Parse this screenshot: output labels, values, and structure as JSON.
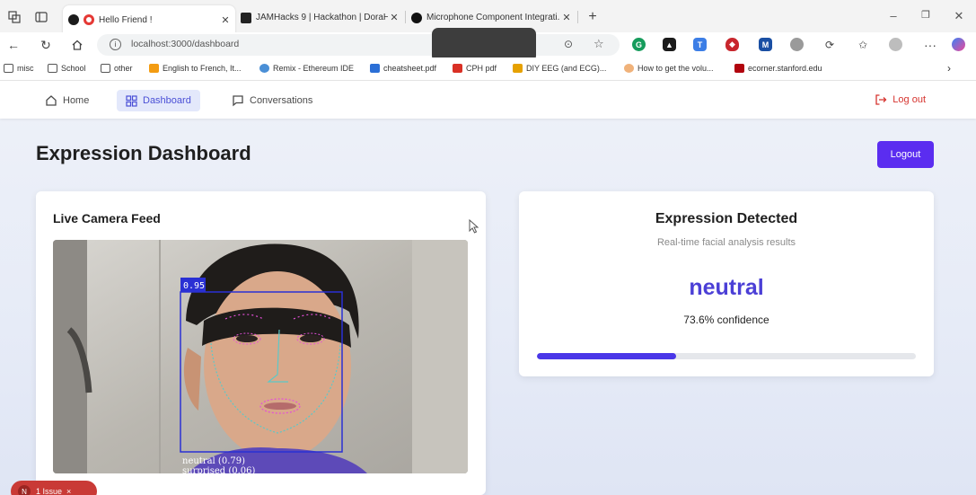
{
  "browser": {
    "tabs": [
      {
        "title": "Hello Friend !",
        "active": true,
        "favicon_color": "#e53935"
      },
      {
        "title": "JAMHacks 9 | Hackathon | DoraH...",
        "active": false,
        "favicon_color": "#222222"
      },
      {
        "title": "Microphone Component Integrati...",
        "active": false,
        "favicon_color": "#111111"
      }
    ],
    "new_tab_label": "+",
    "url": "localhost:3000/dashboard",
    "bookmarks": [
      {
        "label": "misc",
        "icon": "folder-icon"
      },
      {
        "label": "School",
        "icon": "folder-icon"
      },
      {
        "label": "other",
        "icon": "folder-icon"
      },
      {
        "label": "English to French, It...",
        "icon": "wordref-icon"
      },
      {
        "label": "Remix - Ethereum IDE",
        "icon": "remix-icon"
      },
      {
        "label": "cheatsheet.pdf",
        "icon": "doc-icon"
      },
      {
        "label": "CPH pdf",
        "icon": "pdf-icon"
      },
      {
        "label": "DIY EEG (and ECG)...",
        "icon": "hat-icon"
      },
      {
        "label": "How to get the volu...",
        "icon": "hand-icon"
      },
      {
        "label": "ecorner.stanford.edu",
        "icon": "stanford-icon"
      }
    ]
  },
  "app": {
    "nav": {
      "home": "Home",
      "dashboard": "Dashboard",
      "conversations": "Conversations",
      "logout": "Log out"
    },
    "page_title": "Expression Dashboard",
    "logout_button": "Logout",
    "camera_card": {
      "title": "Live Camera Feed",
      "detection_score": "0.95",
      "overlay_line1": "neutral (0.79)",
      "overlay_line2": "surprised (0.06)"
    },
    "expression_card": {
      "title": "Expression Detected",
      "subtitle": "Real-time facial analysis results",
      "expression": "neutral",
      "confidence_text": "73.6% confidence",
      "confidence_value": 0.736
    },
    "issue_badge": {
      "count": "N",
      "label": "1 Issue",
      "close": "×"
    }
  },
  "colors": {
    "accent": "#5b2df0",
    "expression": "#4b3fd6",
    "logout_red": "#d6342f",
    "progress": "#4a37e8"
  }
}
